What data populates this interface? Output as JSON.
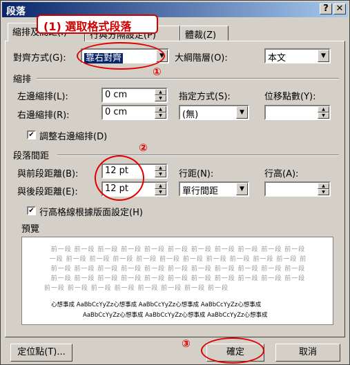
{
  "window": {
    "title": "段落",
    "help_button": "?",
    "close_button": "✕"
  },
  "annotations": {
    "callout": "(1) 選取格式段落",
    "step1": "①",
    "step2": "②",
    "step3": "③"
  },
  "tabs": [
    "縮排及間距(I)",
    "行與分隔設定(P)",
    "體裁(Z)"
  ],
  "alignment": {
    "label": "對齊方式(G):",
    "value": "靠右對齊"
  },
  "outline": {
    "label": "大綱階層(O):",
    "value": "本文"
  },
  "indent": {
    "group": "縮排",
    "left_label": "左邊縮排(L):",
    "left_value": "0 cm",
    "right_label": "右邊縮排(R):",
    "right_value": "0 cm",
    "special_label": "指定方式(S):",
    "special_value": "(無)",
    "by_label": "位移點數(Y):",
    "by_value": "",
    "adjust_right_label": "調整右邊縮排(D)",
    "adjust_right_checked": "✔"
  },
  "spacing": {
    "group": "段落間距",
    "before_label": "與前段距離(B):",
    "before_value": "12 pt",
    "after_label": "與後段距離(E):",
    "after_value": "12 pt",
    "line_label": "行距(N):",
    "line_value": "單行間距",
    "at_label": "行高(A):",
    "at_value": "",
    "grid_label": "行高格線根據版面設定(H)",
    "grid_checked": "✔"
  },
  "preview": {
    "label": "預覽",
    "filler_1": "前一段 前一段 前一段 前一段 前一段 前一段 前一段 前一段 前一段 前一段 前一段",
    "filler_2": "一段 前一段 前一段 前一段 前一段 前一段 前一段 前一段 前一段 前一段 前一段 前",
    "filler_3": "前一段 前一段 前一段 前一段 前一段 前一段 前一段 前一段 前一段 前一段 前一段",
    "filler_4": "前一段 前一段 前一段 前一段 前一段 前一段 前一段 前一段 前一段 前一段 前一段",
    "filler_5": "前一段 前一段 前一段 前一段 前一段 前一段 前一段 前一段",
    "sample_1": "心想事成  AaBbCcYyZz心想事成  AaBbCcYyZz心想事成  AaBbCcYyZz心想事成",
    "sample_2": "AaBbCcYyZz心想事成  AaBbCcYyZz心想事成  AaBbCcYyZz心想事成"
  },
  "footer": {
    "tabs_button": "定位點(T)...",
    "ok_button": "確定",
    "cancel_button": "取消"
  }
}
